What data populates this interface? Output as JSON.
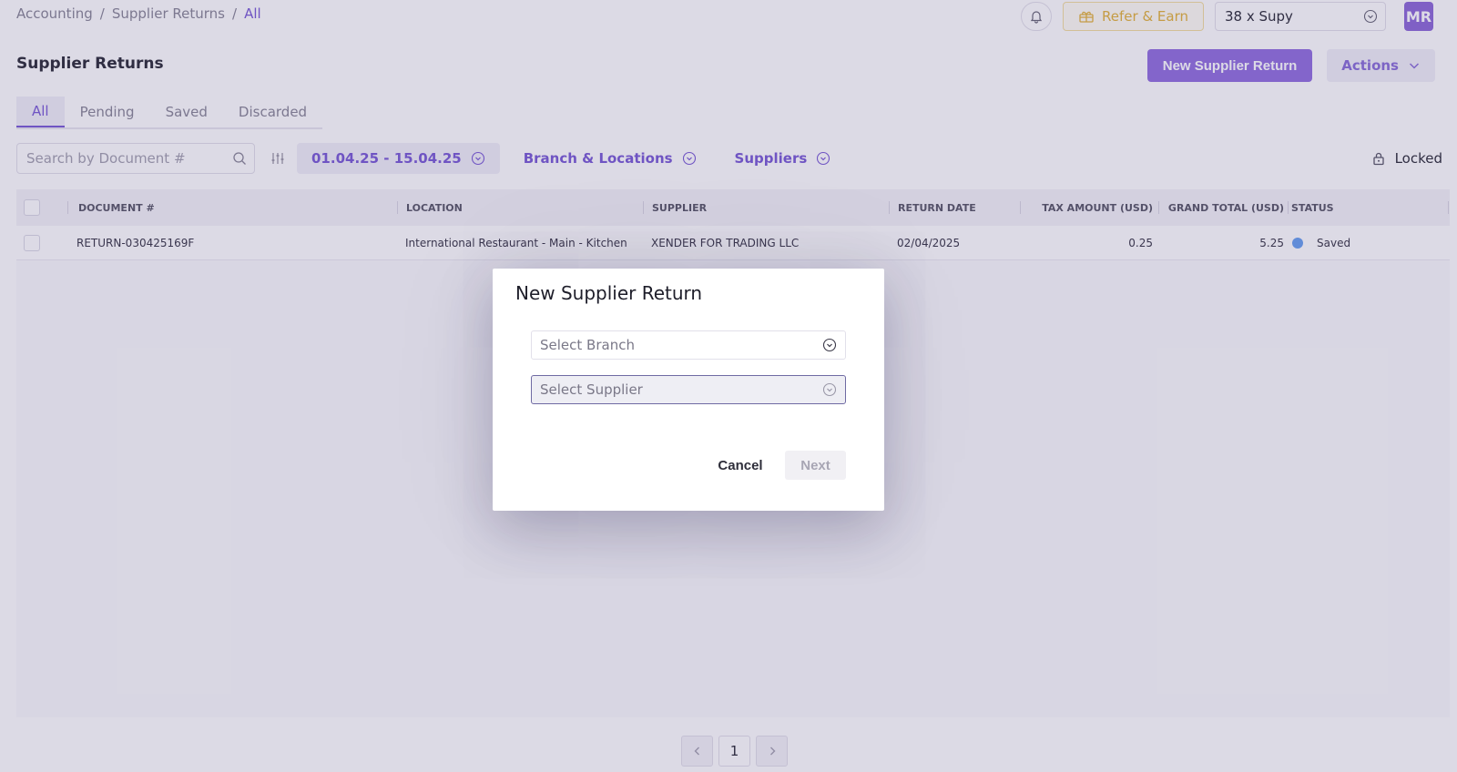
{
  "breadcrumb": {
    "items": [
      "Accounting",
      "Supplier Returns",
      "All"
    ],
    "sep": "/"
  },
  "topbar": {
    "refer_label": "Refer & Earn",
    "org_name": "38 x Supy",
    "avatar_initials": "MR"
  },
  "page": {
    "title": "Supplier Returns",
    "new_button": "New Supplier Return",
    "actions_button": "Actions"
  },
  "tabs": [
    {
      "label": "All",
      "active": true
    },
    {
      "label": "Pending",
      "active": false
    },
    {
      "label": "Saved",
      "active": false
    },
    {
      "label": "Discarded",
      "active": false
    }
  ],
  "filters": {
    "search_placeholder": "Search by Document #",
    "date_range": "01.04.25 - 15.04.25",
    "branch_filter": "Branch & Locations",
    "supplier_filter": "Suppliers",
    "locked_label": "Locked"
  },
  "table": {
    "columns": [
      "DOCUMENT #",
      "LOCATION",
      "SUPPLIER",
      "RETURN DATE",
      "TAX AMOUNT (USD)",
      "GRAND TOTAL (USD)",
      "STATUS"
    ],
    "rows": [
      {
        "document": "RETURN-030425169F",
        "location": "International Restaurant - Main - Kitchen",
        "supplier": "XENDER FOR TRADING LLC",
        "return_date": "02/04/2025",
        "tax": "0.25",
        "total": "5.25",
        "status": "Saved"
      }
    ]
  },
  "pagination": {
    "current": "1"
  },
  "modal": {
    "title": "New Supplier Return",
    "branch_placeholder": "Select Branch",
    "supplier_placeholder": "Select Supplier",
    "cancel": "Cancel",
    "next": "Next"
  },
  "colors": {
    "accent": "#7b5cd6",
    "primary_button": "#9371e0",
    "status_saved": "#6aa0f0",
    "refer": "#e3b43c"
  }
}
